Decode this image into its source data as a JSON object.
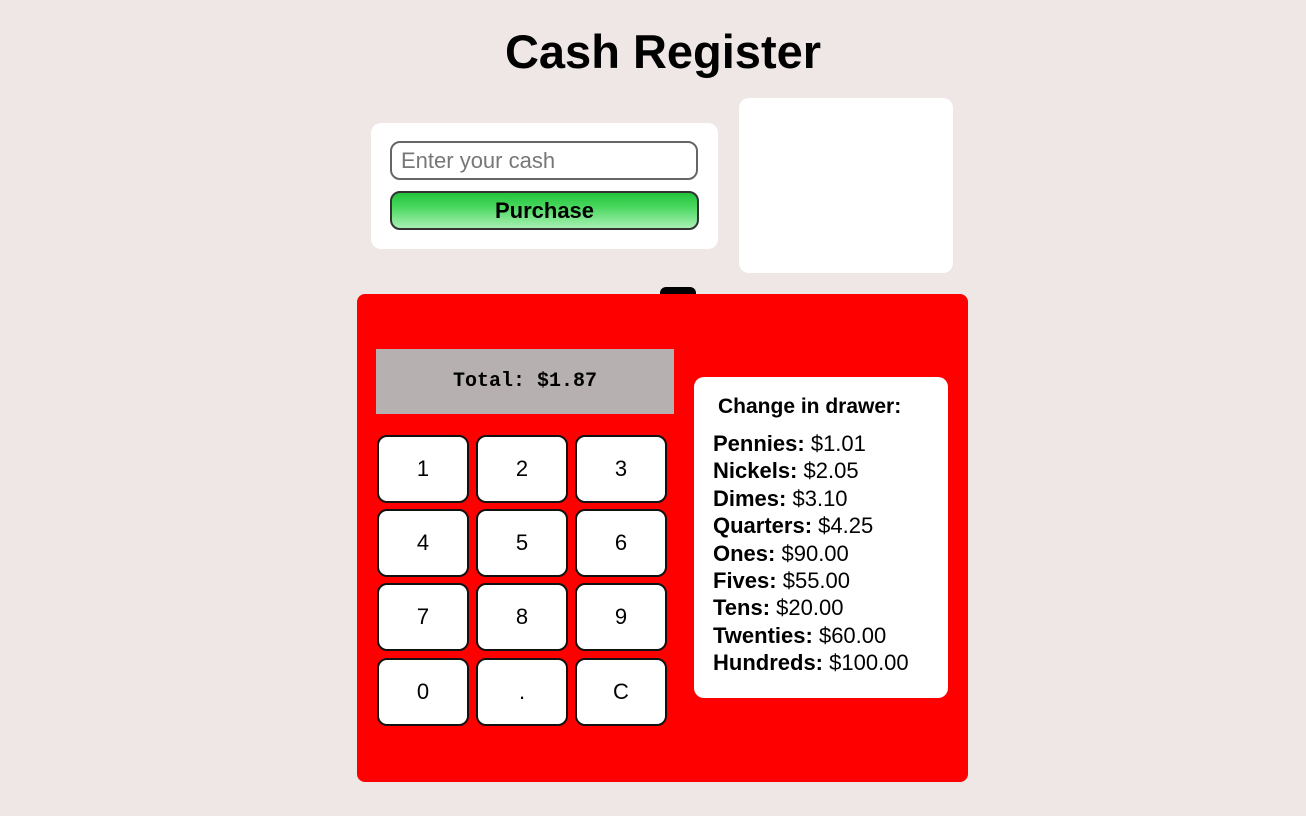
{
  "page": {
    "title": "Cash Register"
  },
  "purchase_form": {
    "cash_input_value": "",
    "cash_input_placeholder": "Enter your cash",
    "purchase_label": "Purchase"
  },
  "register": {
    "total_text": "Total: $1.87",
    "keys": [
      {
        "label": "1"
      },
      {
        "label": "2"
      },
      {
        "label": "3"
      },
      {
        "label": "4"
      },
      {
        "label": "5"
      },
      {
        "label": "6"
      },
      {
        "label": "7"
      },
      {
        "label": "8"
      },
      {
        "label": "9"
      },
      {
        "label": "0"
      },
      {
        "label": "."
      },
      {
        "label": "C"
      }
    ]
  },
  "drawer": {
    "title": "Change in drawer:",
    "items": [
      {
        "name": "Pennies:",
        "amount": "$1.01"
      },
      {
        "name": "Nickels:",
        "amount": "$2.05"
      },
      {
        "name": "Dimes:",
        "amount": "$3.10"
      },
      {
        "name": "Quarters:",
        "amount": "$4.25"
      },
      {
        "name": "Ones:",
        "amount": "$90.00"
      },
      {
        "name": "Fives:",
        "amount": "$55.00"
      },
      {
        "name": "Tens:",
        "amount": "$20.00"
      },
      {
        "name": "Twenties:",
        "amount": "$60.00"
      },
      {
        "name": "Hundreds:",
        "amount": "$100.00"
      }
    ]
  },
  "colors": {
    "page_background": "#efe6e6",
    "register_body": "#ff0000",
    "total_screen": "#b6b0b0",
    "purchase_button": "#3cce52"
  }
}
